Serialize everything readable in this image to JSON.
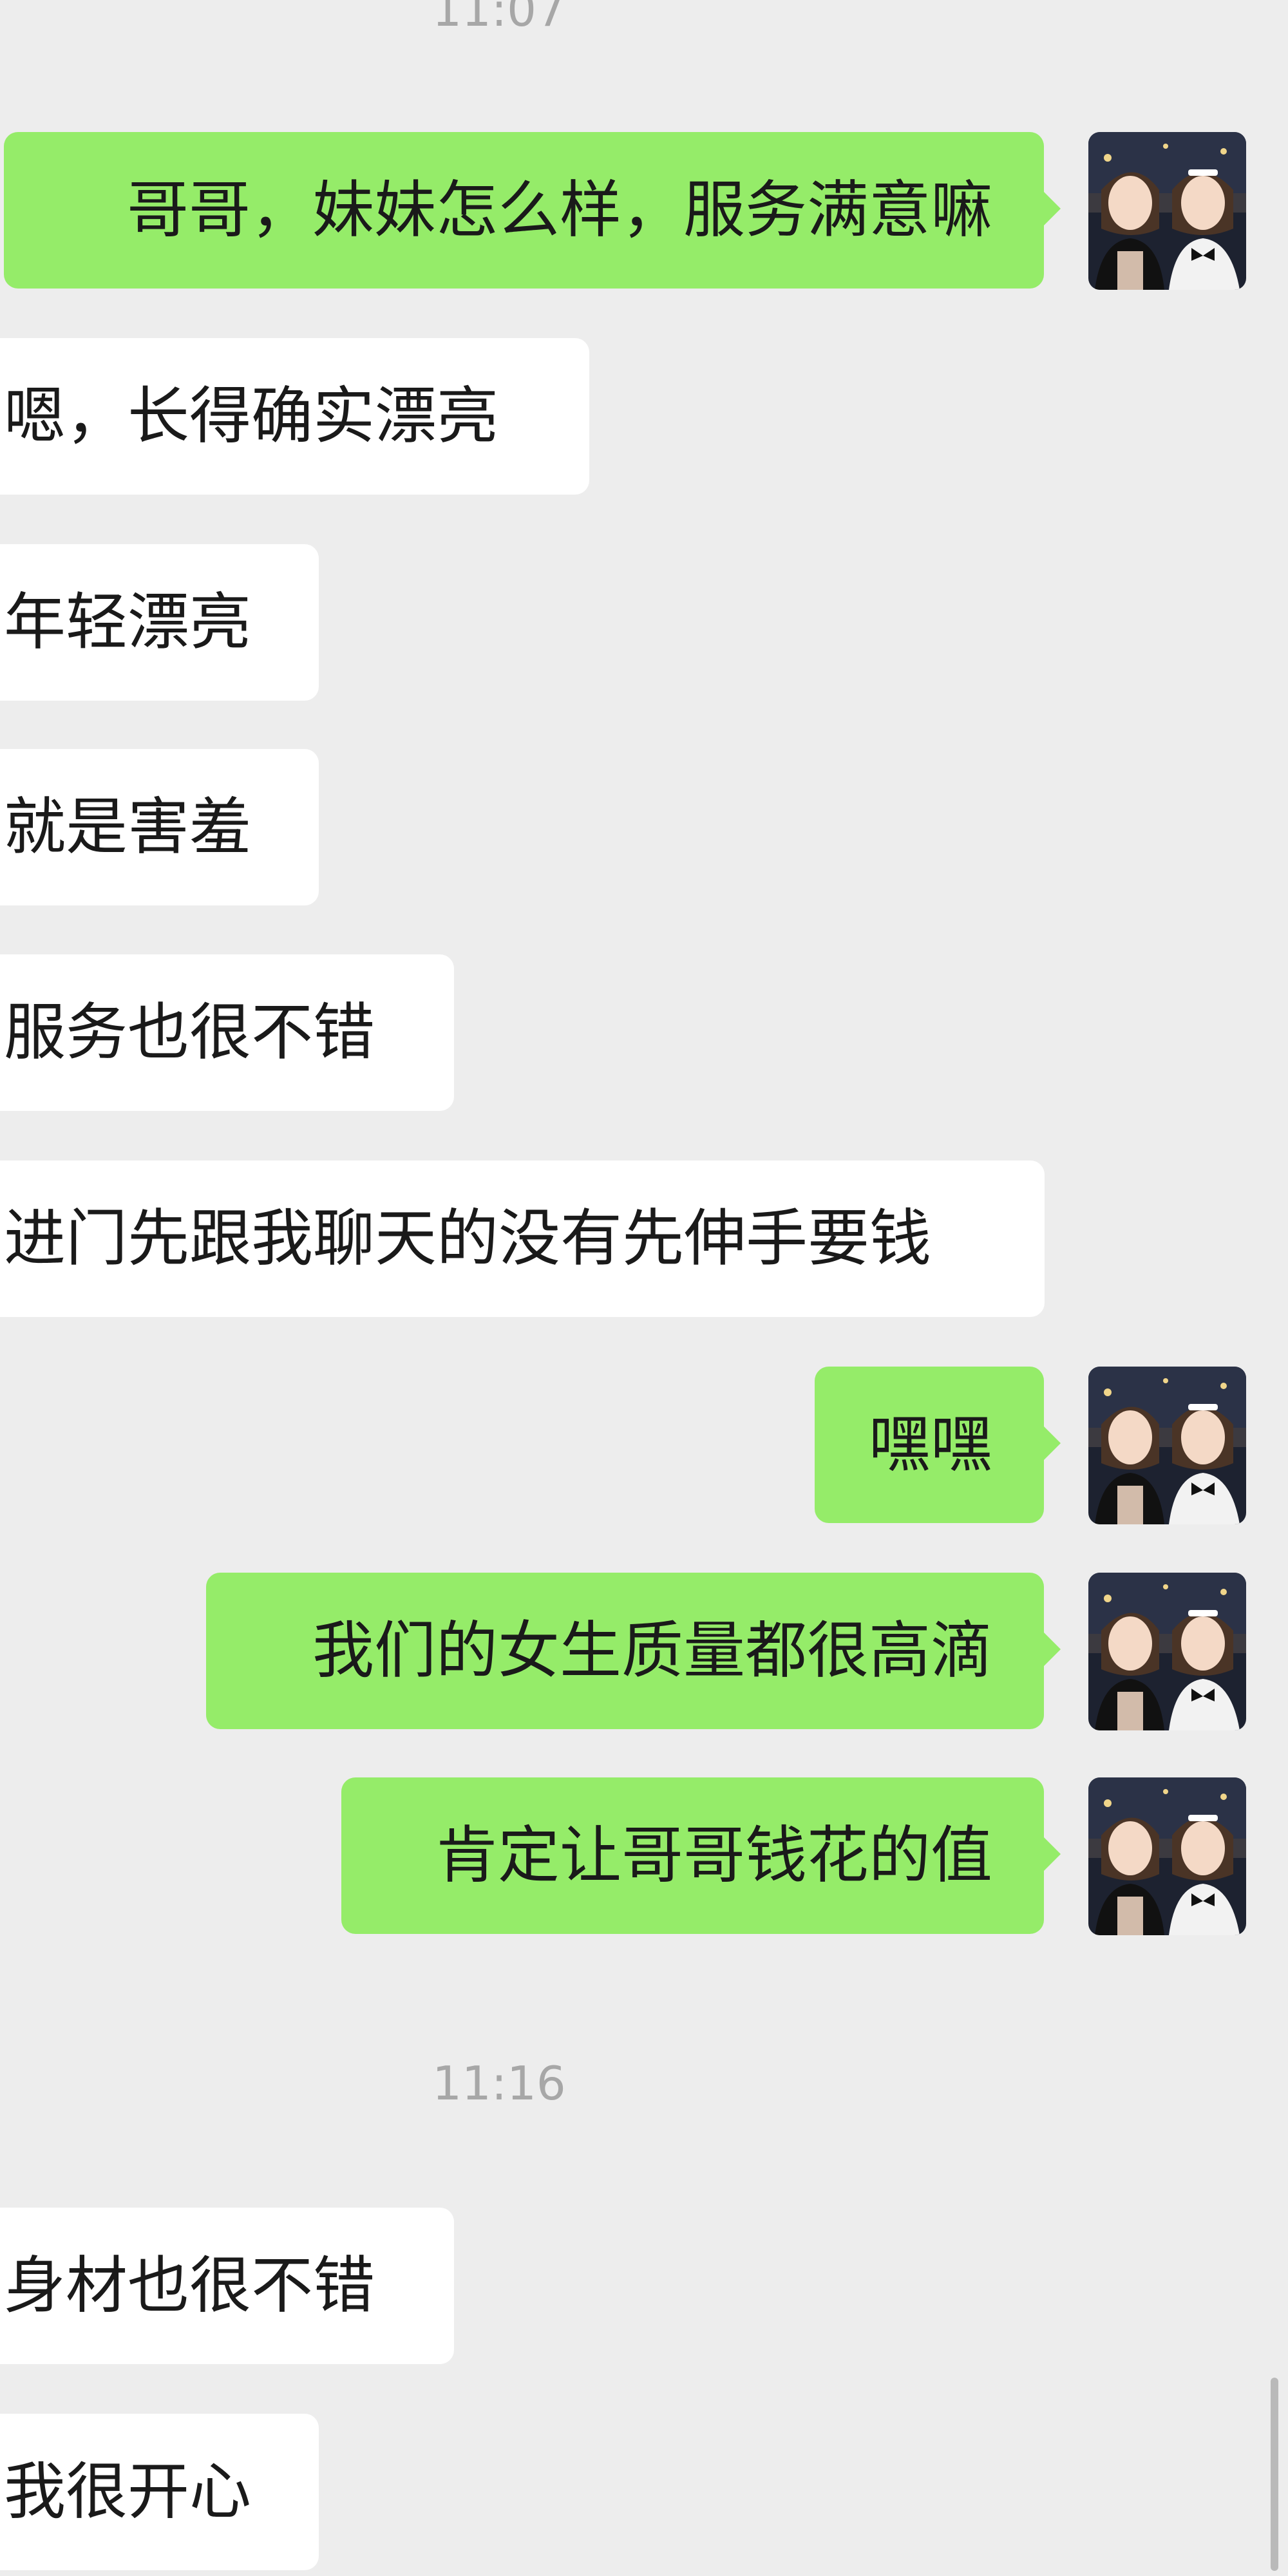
{
  "colors": {
    "background": "#ededed",
    "outgoing_bubble": "#95ec69",
    "incoming_bubble": "#ffffff",
    "timestamp": "#a7a7a7"
  },
  "timestamps": [
    "11:07",
    "11:16"
  ],
  "messages": [
    {
      "side": "out",
      "text": "哥哥，妹妹怎么样，服务满意嘛"
    },
    {
      "side": "in",
      "text": "嗯，长得确实漂亮"
    },
    {
      "side": "in",
      "text": "年轻漂亮"
    },
    {
      "side": "in",
      "text": "就是害羞"
    },
    {
      "side": "in",
      "text": "服务也很不错"
    },
    {
      "side": "in",
      "text": "进门先跟我聊天的没有先伸手要钱"
    },
    {
      "side": "out",
      "text": "嘿嘿"
    },
    {
      "side": "out",
      "text": "我们的女生质量都很高滴"
    },
    {
      "side": "out",
      "text": "肯定让哥哥钱花的值"
    },
    {
      "side": "in",
      "text": "身材也很不错"
    },
    {
      "side": "in",
      "text": "我很开心"
    }
  ],
  "avatar": {
    "icon": "two-girls-photo-avatar"
  }
}
